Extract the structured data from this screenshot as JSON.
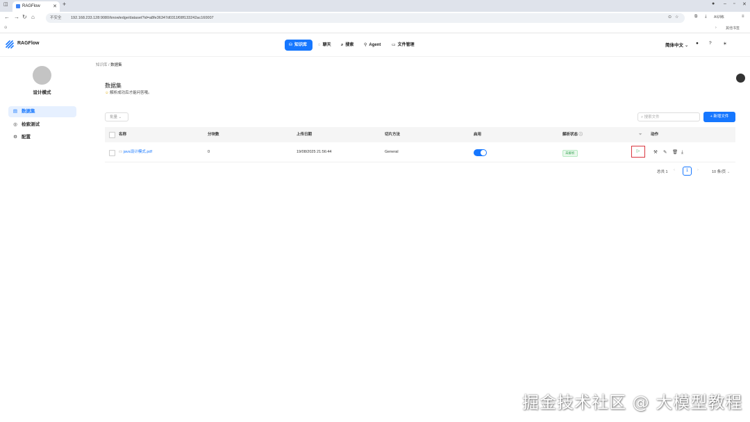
{
  "browser": {
    "tab_title": "RAGFlow",
    "security_label": "不安全",
    "url": "192.168.233.128:9080/knowledge/dataset?id=a8fe36347d0311f08f133242ac160007",
    "profile_label": "AI训练",
    "bookmarks_label": "其他书签"
  },
  "header": {
    "brand": "RAGFlow",
    "nav": [
      {
        "label": "知识库",
        "icon": "database-icon"
      },
      {
        "label": "聊天",
        "icon": "chat-icon"
      },
      {
        "label": "搜索",
        "icon": "search-icon"
      },
      {
        "label": "Agent",
        "icon": "agent-icon"
      },
      {
        "label": "文件管理",
        "icon": "folder-icon"
      }
    ],
    "language": "简体中文"
  },
  "sidebar": {
    "name": "设计模式",
    "items": [
      {
        "label": "数据集",
        "icon": "file-icon"
      },
      {
        "label": "检索测试",
        "icon": "retrieval-icon"
      },
      {
        "label": "配置",
        "icon": "gear-icon"
      }
    ]
  },
  "breadcrumb": {
    "parent": "知识库",
    "current": "数据集"
  },
  "page": {
    "title": "数据集",
    "subtitle": "解析成功后才能问答哦。",
    "filter_label": "批量",
    "search_placeholder": "搜索文件",
    "add_button": "+ 新增文件"
  },
  "table": {
    "headers": [
      "名称",
      "分块数",
      "上传日期",
      "切片方法",
      "启用",
      "解析状态",
      "动作"
    ],
    "rows": [
      {
        "name": "java设计模式.pdf",
        "chunks": "0",
        "date": "19/08/2025 21:56:44",
        "method": "General",
        "enabled": true,
        "status": "未解析"
      }
    ]
  },
  "pagination": {
    "total": "总共 1",
    "current": "1",
    "page_size": "10 条/页"
  },
  "watermark": "掘金技术社区 @ 大模型教程",
  "colors": {
    "primary": "#1677ff",
    "highlight_border": "#d9363e",
    "status_green": "#3aa655"
  }
}
